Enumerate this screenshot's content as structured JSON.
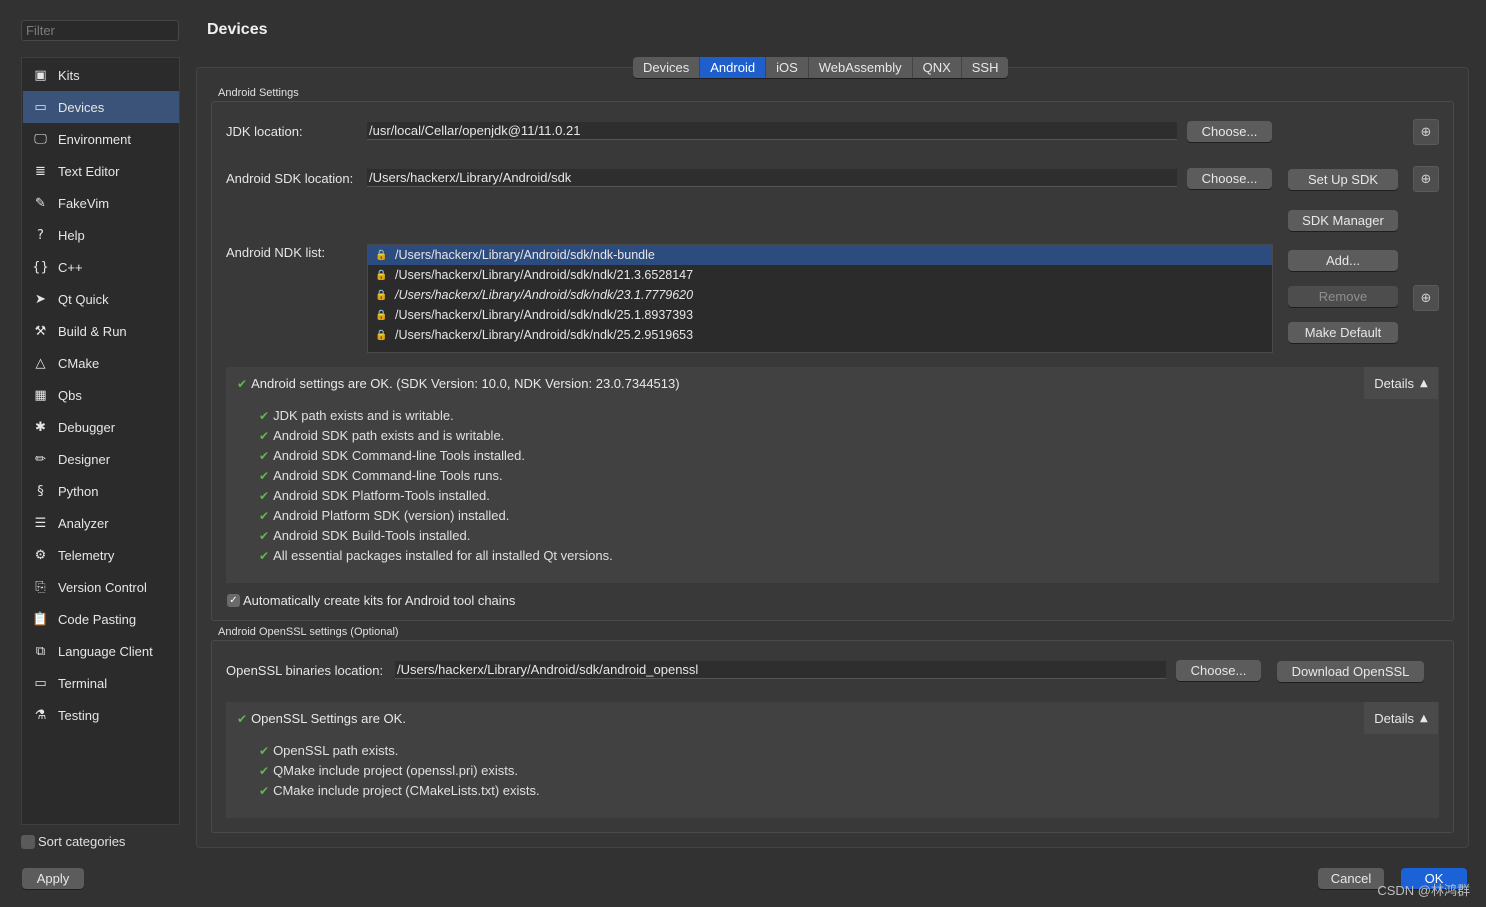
{
  "sidebar": {
    "filter_placeholder": "Filter",
    "items": [
      {
        "label": "Kits",
        "icon": "kits-icon",
        "glyph": "▣"
      },
      {
        "label": "Devices",
        "icon": "devices-icon",
        "glyph": "▭",
        "selected": true
      },
      {
        "label": "Environment",
        "icon": "monitor-icon",
        "glyph": "🖵"
      },
      {
        "label": "Text Editor",
        "icon": "text-editor-icon",
        "glyph": "≣"
      },
      {
        "label": "FakeVim",
        "icon": "fakevim-icon",
        "glyph": "✎"
      },
      {
        "label": "Help",
        "icon": "help-icon",
        "glyph": "?"
      },
      {
        "label": "C++",
        "icon": "braces-icon",
        "glyph": "{}"
      },
      {
        "label": "Qt Quick",
        "icon": "qt-quick-icon",
        "glyph": "➤"
      },
      {
        "label": "Build & Run",
        "icon": "hammer-icon",
        "glyph": "⚒"
      },
      {
        "label": "CMake",
        "icon": "cmake-icon",
        "glyph": "△"
      },
      {
        "label": "Qbs",
        "icon": "qbs-icon",
        "glyph": "▦"
      },
      {
        "label": "Debugger",
        "icon": "bug-icon",
        "glyph": "✱"
      },
      {
        "label": "Designer",
        "icon": "pencil-icon",
        "glyph": "✏"
      },
      {
        "label": "Python",
        "icon": "python-icon",
        "glyph": "§"
      },
      {
        "label": "Analyzer",
        "icon": "analyzer-icon",
        "glyph": "☰"
      },
      {
        "label": "Telemetry",
        "icon": "telemetry-icon",
        "glyph": "⚙"
      },
      {
        "label": "Version Control",
        "icon": "version-control-icon",
        "glyph": "⎘"
      },
      {
        "label": "Code Pasting",
        "icon": "clipboard-icon",
        "glyph": "📋"
      },
      {
        "label": "Language Client",
        "icon": "language-client-icon",
        "glyph": "⧉"
      },
      {
        "label": "Terminal",
        "icon": "terminal-icon",
        "glyph": "▭"
      },
      {
        "label": "Testing",
        "icon": "testing-icon",
        "glyph": "⚗"
      }
    ],
    "sort_label": "Sort categories",
    "apply_label": "Apply"
  },
  "page_title": "Devices",
  "tabs": [
    {
      "label": "Devices"
    },
    {
      "label": "Android",
      "active": true
    },
    {
      "label": "iOS"
    },
    {
      "label": "WebAssembly"
    },
    {
      "label": "QNX"
    },
    {
      "label": "SSH"
    }
  ],
  "android": {
    "group_title": "Android Settings",
    "jdk_label": "JDK location:",
    "jdk_value": "/usr/local/Cellar/openjdk@11/11.0.21",
    "sdk_label": "Android SDK location:",
    "sdk_value": "/Users/hackerx/Library/Android/sdk",
    "choose_label": "Choose...",
    "setup_sdk_label": "Set Up SDK",
    "sdk_manager_label": "SDK Manager",
    "ndk_label": "Android NDK list:",
    "ndk_items": [
      {
        "path": "/Users/hackerx/Library/Android/sdk/ndk-bundle",
        "selected": true
      },
      {
        "path": "/Users/hackerx/Library/Android/sdk/ndk/21.3.6528147"
      },
      {
        "path": "/Users/hackerx/Library/Android/sdk/ndk/23.1.7779620",
        "italic": true
      },
      {
        "path": "/Users/hackerx/Library/Android/sdk/ndk/25.1.8937393"
      },
      {
        "path": "/Users/hackerx/Library/Android/sdk/ndk/25.2.9519653"
      }
    ],
    "add_label": "Add...",
    "remove_label": "Remove",
    "make_default_label": "Make Default",
    "status": "Android settings are OK. (SDK Version: 10.0, NDK Version: 23.0.7344513)",
    "details_label": "Details",
    "checks": [
      "JDK path exists and is writable.",
      "Android SDK path exists and is writable.",
      "Android SDK Command-line Tools installed.",
      "Android SDK Command-line Tools runs.",
      "Android SDK Platform-Tools installed.",
      "Android Platform SDK (version) installed.",
      "Android SDK Build-Tools installed.",
      "All essential packages installed for all installed Qt versions."
    ],
    "auto_kits_label": "Automatically create kits for Android tool chains"
  },
  "openssl": {
    "group_title": "Android OpenSSL settings (Optional)",
    "location_label": "OpenSSL binaries location:",
    "location_value": "/Users/hackerx/Library/Android/sdk/android_openssl",
    "choose_label": "Choose...",
    "download_label": "Download OpenSSL",
    "status": "OpenSSL Settings are OK.",
    "details_label": "Details",
    "checks": [
      "OpenSSL path exists.",
      "QMake include project (openssl.pri) exists.",
      "CMake include project (CMakeLists.txt) exists."
    ]
  },
  "footer": {
    "cancel_label": "Cancel",
    "ok_label": "OK"
  },
  "watermark": "CSDN @林鸿群",
  "colors": {
    "accent": "#1f5fcc",
    "selected_sidebar": "#3b5379",
    "check_green": "#5fb84a"
  }
}
